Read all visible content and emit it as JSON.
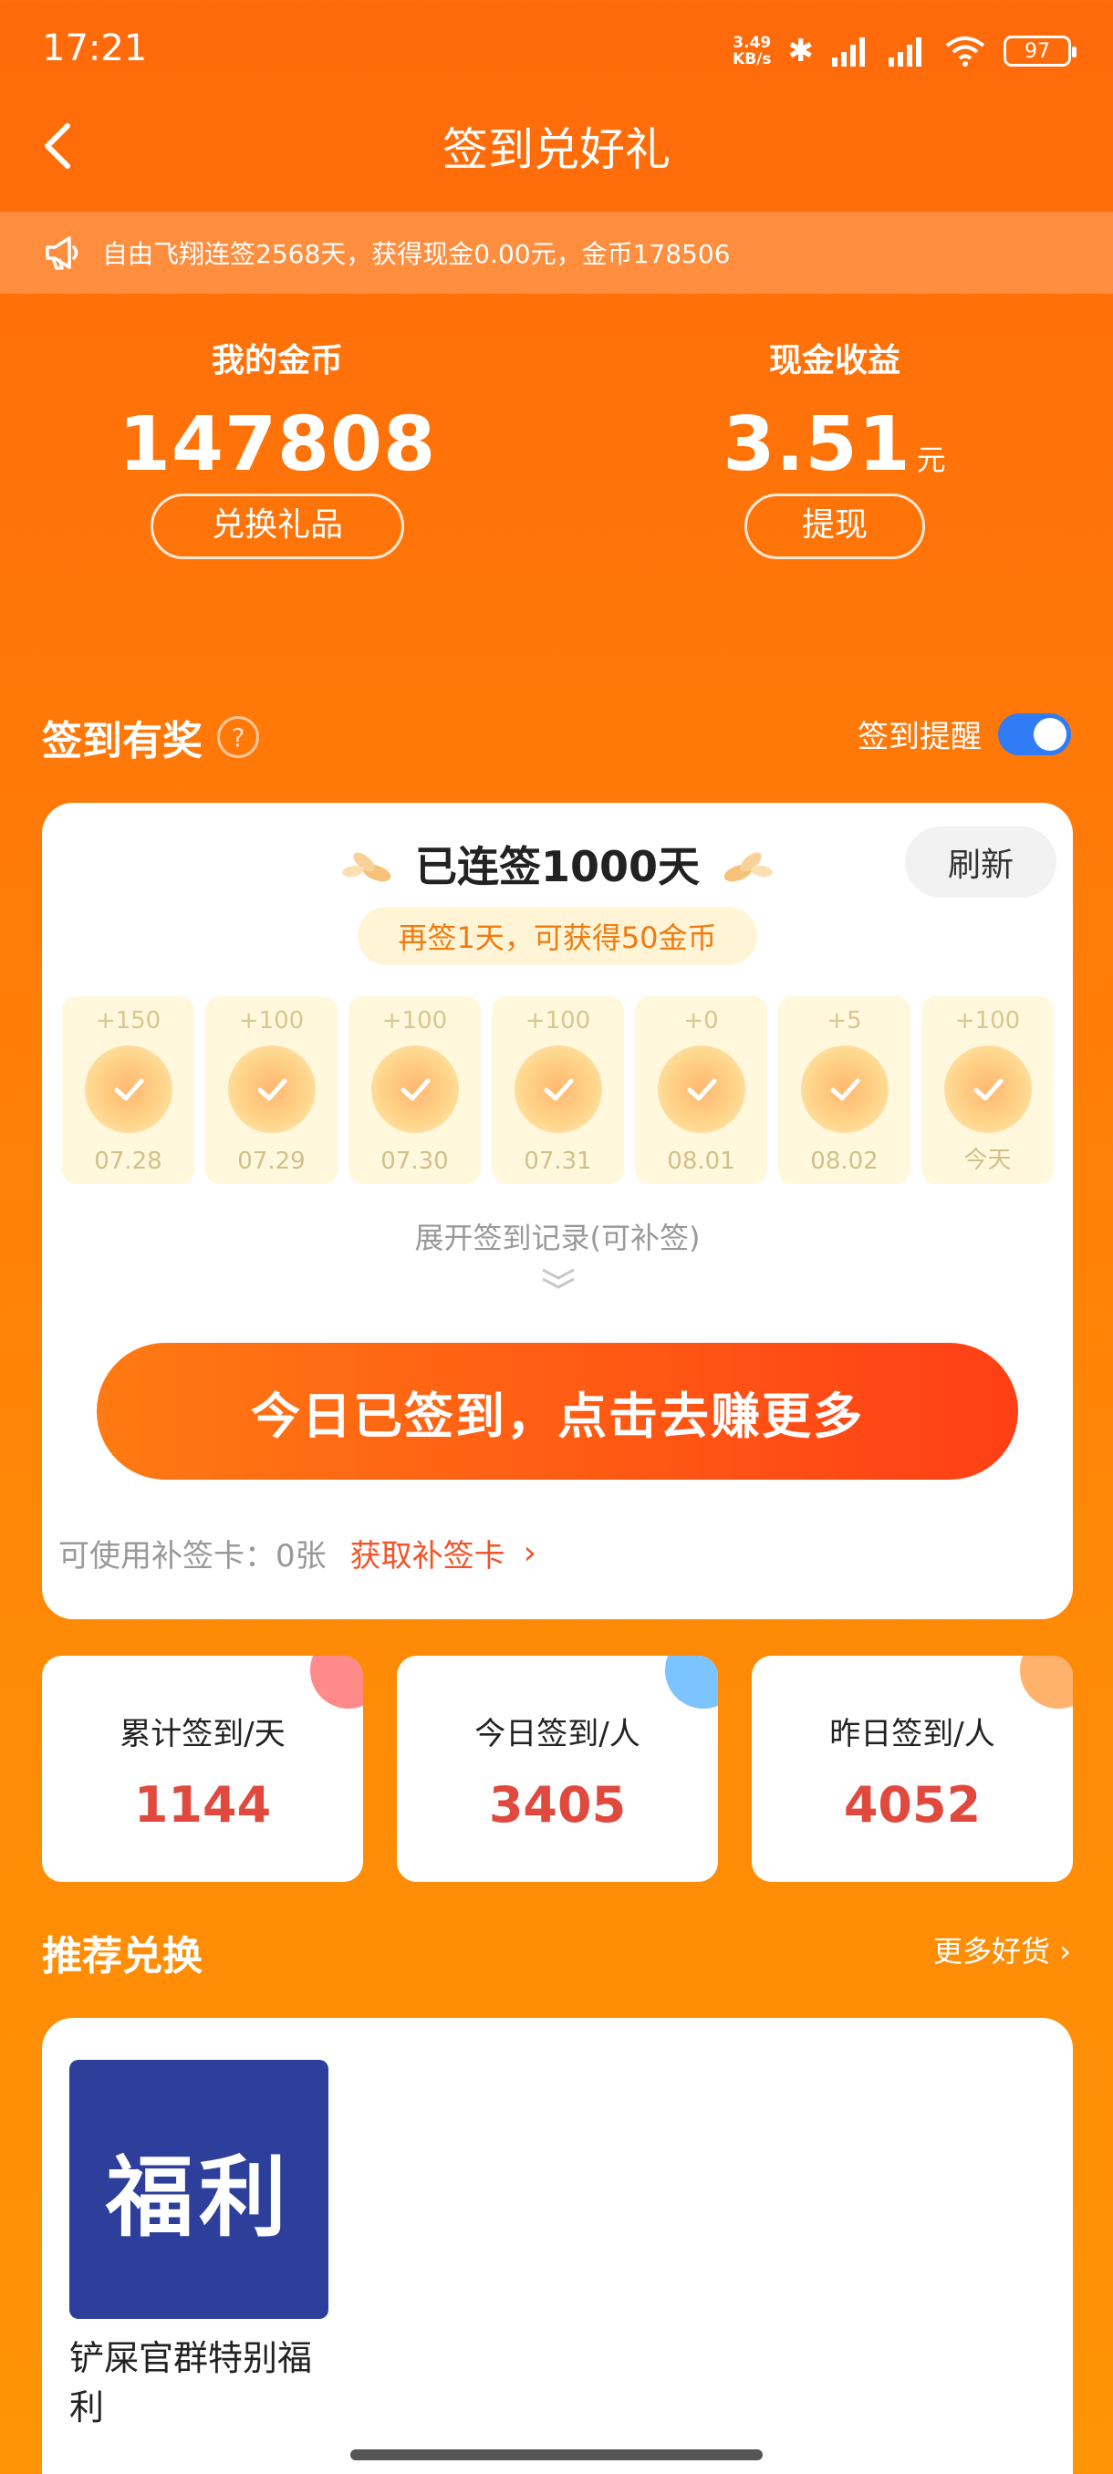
{
  "status_bar": {
    "time": "17:21",
    "net_speed_top": "3.49",
    "net_speed_bottom": "KB/s",
    "battery": "97"
  },
  "header": {
    "title": "签到兑好礼",
    "back_icon": "chevron-left-icon"
  },
  "notice": {
    "icon": "megaphone-icon",
    "text": "自由飞翔连签2568天，获得现金0.00元，金币178506"
  },
  "assets": {
    "coins": {
      "label": "我的金币",
      "value": "147808",
      "button": "兑换礼品"
    },
    "cash": {
      "label": "现金收益",
      "value": "3.51",
      "unit": "元",
      "button": "提现"
    }
  },
  "signin": {
    "title": "签到有奖",
    "help_icon": "?",
    "reminder_label": "签到提醒",
    "reminder_on": true,
    "streak": "已连签1000天",
    "refresh": "刷新",
    "tip": "再签1天，可获得50金币",
    "days": [
      {
        "points": "+150",
        "date": "07.28"
      },
      {
        "points": "+100",
        "date": "07.29"
      },
      {
        "points": "+100",
        "date": "07.30"
      },
      {
        "points": "+100",
        "date": "07.31"
      },
      {
        "points": "+0",
        "date": "08.01"
      },
      {
        "points": "+5",
        "date": "08.02"
      },
      {
        "points": "+100",
        "date": "今天"
      }
    ],
    "expand": "展开签到记录(可补签)",
    "main_button": "今日已签到，点击去赚更多",
    "makeup_label": "可使用补签卡：0张",
    "makeup_link": "获取补签卡",
    "link_chevron": "›"
  },
  "stats": [
    {
      "label": "累计签到/天",
      "value": "1144",
      "color": "#ff8a8a"
    },
    {
      "label": "今日签到/人",
      "value": "3405",
      "color": "#7cc4ff"
    },
    {
      "label": "昨日签到/人",
      "value": "4052",
      "color": "#ffb26b"
    }
  ],
  "recommend": {
    "title": "推荐兑换",
    "more": "更多好货 ›",
    "items": [
      {
        "image_text": "福利",
        "name": "铲屎官群特别福利"
      }
    ]
  },
  "colors": {
    "accent": "#ff6a0a",
    "value_red": "#e04a3e",
    "toggle_blue": "#2f7cf6"
  }
}
